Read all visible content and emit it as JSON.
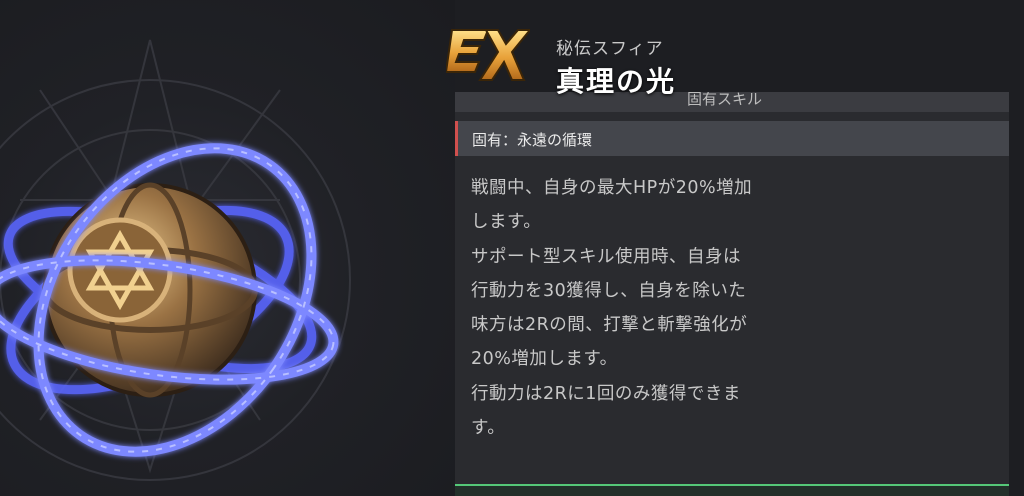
{
  "skill": {
    "rank_badge": "EX",
    "category": "秘伝スフィア",
    "name": "真理の光",
    "section_header": "固有スキル",
    "skill_label": "固有：永遠の循環",
    "description_lines": [
      "戦闘中、自身の最大HPが20%増加",
      "します。",
      "サポート型スキル使用時、自身は",
      "行動力を30獲得し、自身を除いた",
      "味方は2Rの間、打撃と斬撃強化が",
      "20%増加します。",
      "行動力は2Rに1回のみ獲得できま",
      "す。"
    ]
  },
  "colors": {
    "background": "#1d1e22",
    "panel": "#2a2b2f",
    "skill_bar": "#44464c",
    "skill_bar_accent": "#d0504e",
    "badge_gold": "#e8a23a",
    "ring_glow": "#6e7bff",
    "bottom_accent": "#55c878"
  },
  "icons": {
    "badge": "ex-rank-icon",
    "sphere": "sphere-orb-icon"
  }
}
